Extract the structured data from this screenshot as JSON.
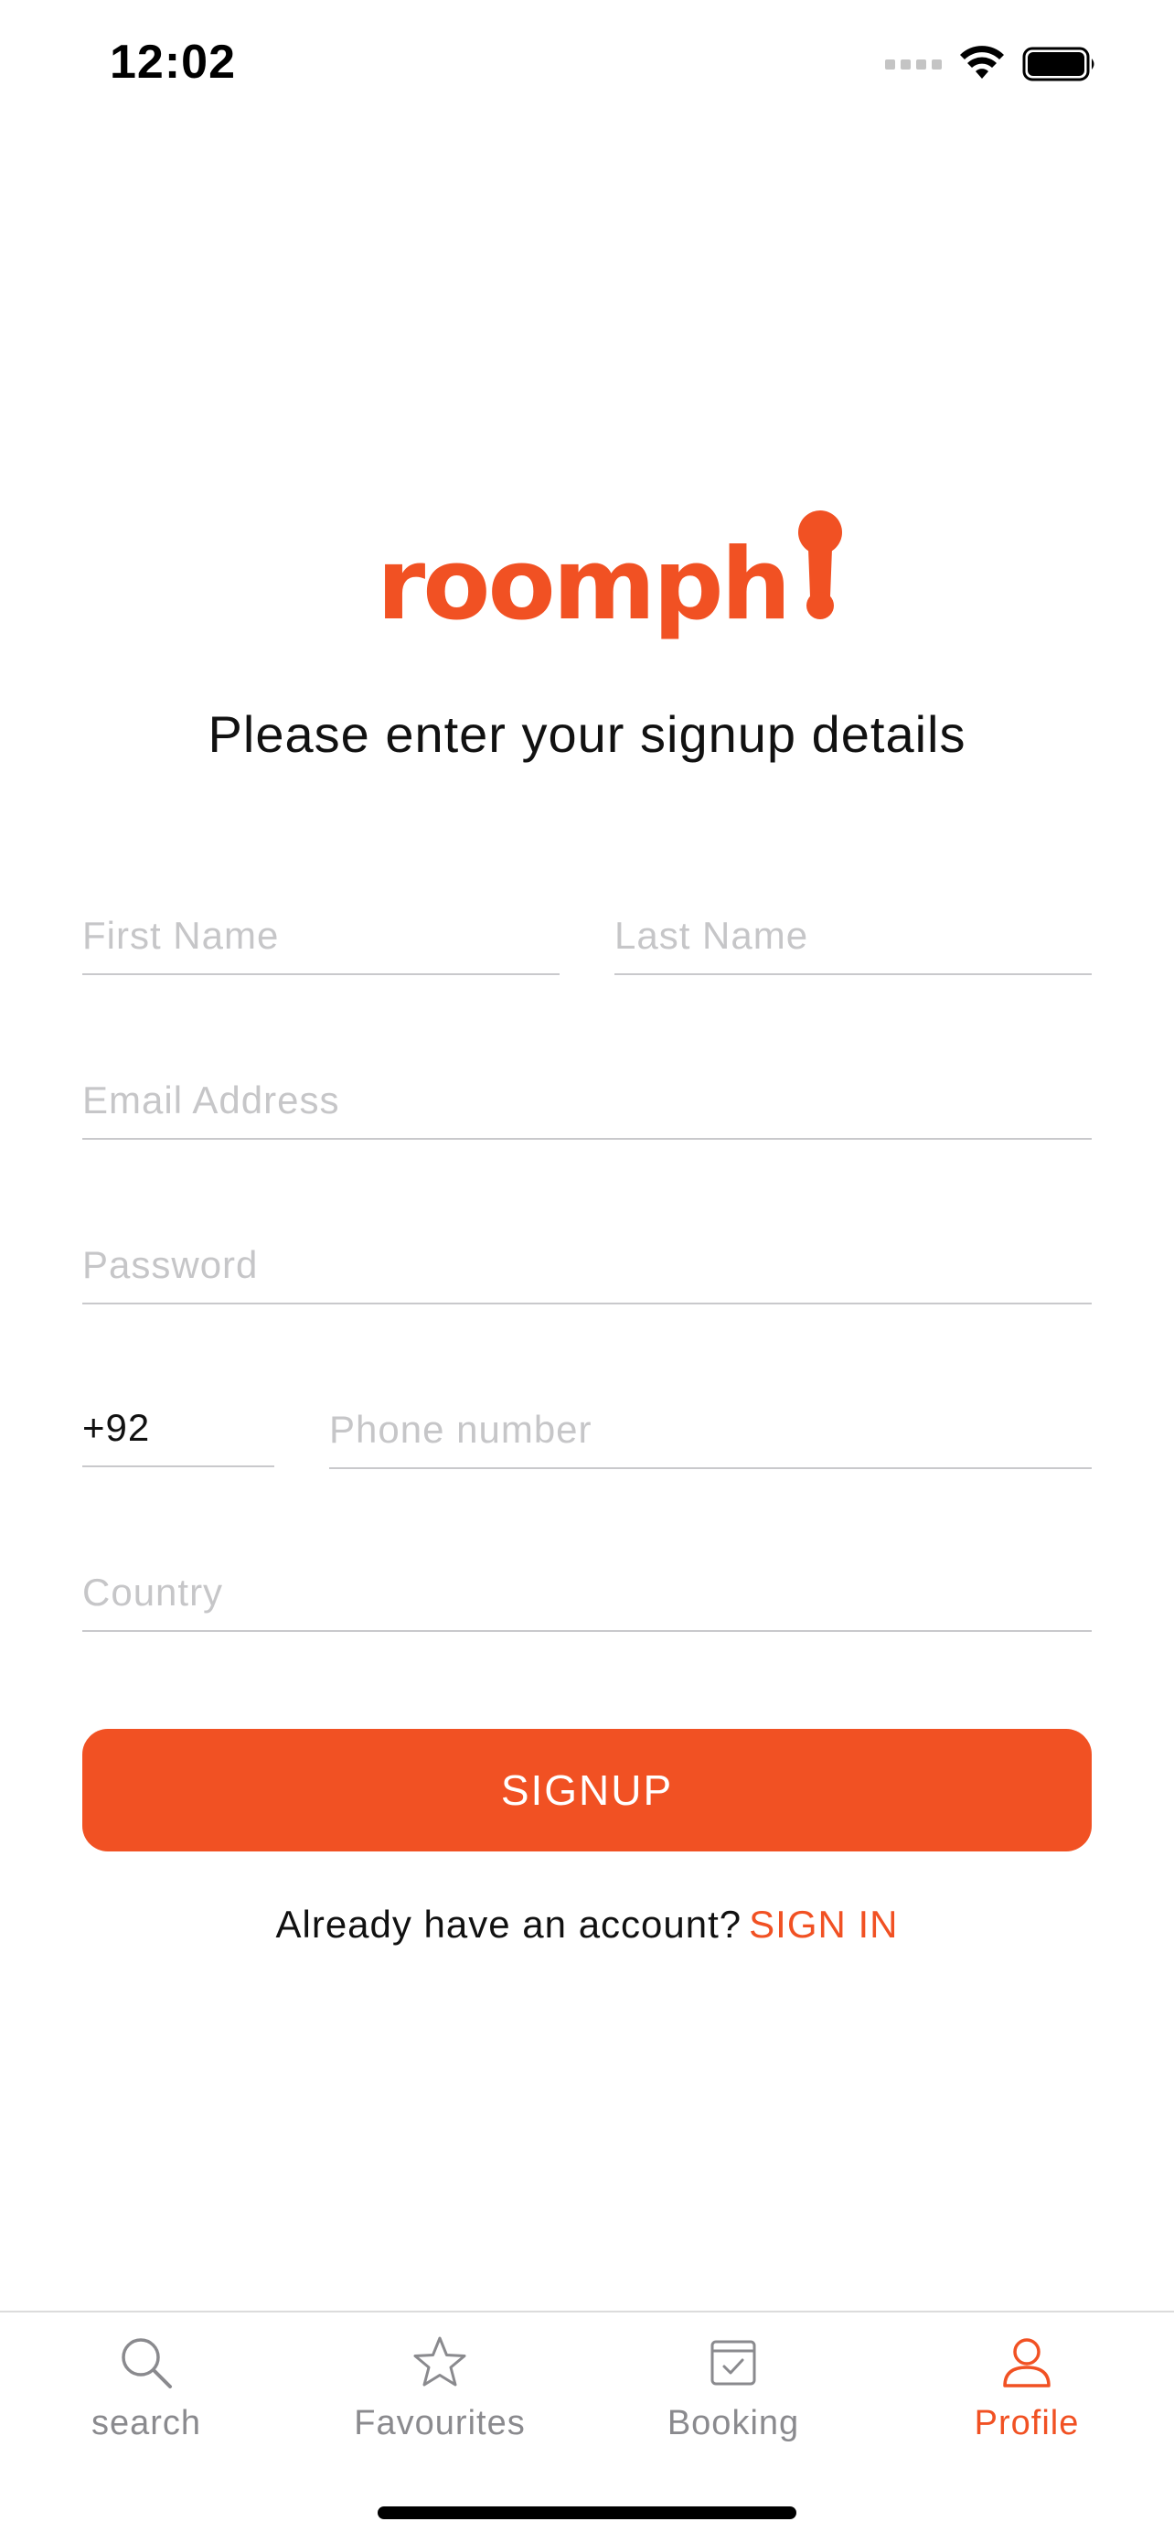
{
  "status_bar": {
    "time": "12:02"
  },
  "brand": {
    "name": "roomph",
    "accent_color": "#f15123"
  },
  "heading": "Please enter your signup details",
  "form": {
    "first_name": {
      "placeholder": "First Name",
      "value": ""
    },
    "last_name": {
      "placeholder": "Last Name",
      "value": ""
    },
    "email": {
      "placeholder": "Email Address",
      "value": ""
    },
    "password": {
      "placeholder": "Password",
      "value": ""
    },
    "country_code": {
      "value": "+92"
    },
    "phone": {
      "placeholder": "Phone number",
      "value": ""
    },
    "country": {
      "placeholder": "Country",
      "value": ""
    },
    "submit_label": "SIGNUP"
  },
  "signin": {
    "prompt": "Already have an account?",
    "link_label": "SIGN IN"
  },
  "tabs": [
    {
      "label": "search",
      "icon": "search-icon",
      "active": false
    },
    {
      "label": "Favourites",
      "icon": "star-icon",
      "active": false
    },
    {
      "label": "Booking",
      "icon": "calendar-check-icon",
      "active": false
    },
    {
      "label": "Profile",
      "icon": "user-icon",
      "active": true
    }
  ]
}
